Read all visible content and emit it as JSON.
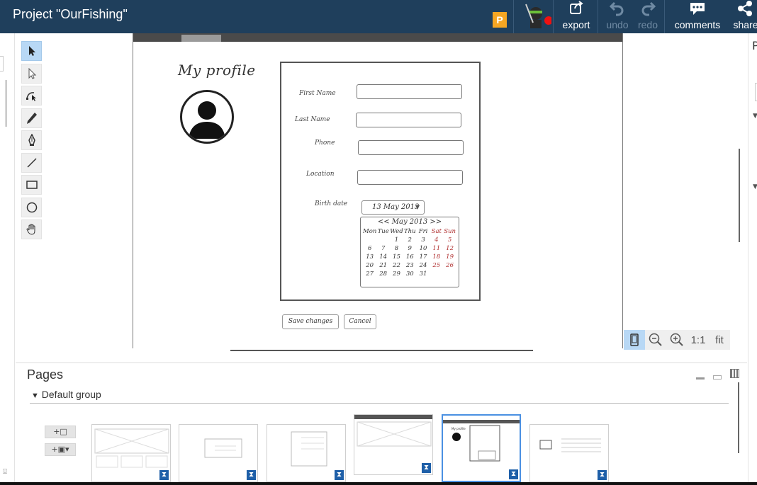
{
  "app": {
    "title": "Project \"OurFishing\"",
    "badge": "P"
  },
  "toolbar": {
    "export_label": "export",
    "undo_label": "undo",
    "redo_label": "redo",
    "comments_label": "comments",
    "share_label": "share"
  },
  "tools": [
    "select-icon",
    "direct-select-icon",
    "bezier-icon",
    "pencil-icon",
    "pen-icon",
    "line-icon",
    "rectangle-icon",
    "ellipse-icon",
    "hand-icon"
  ],
  "mockup": {
    "title": "My profile",
    "fields": [
      "First Name",
      "Last Name",
      "Phone",
      "Location"
    ],
    "birth_label": "Birth date",
    "birth_value": "13 May 2013",
    "calendar": {
      "header": "<< May 2013 >>",
      "weekdays": [
        "Mon",
        "Tue",
        "Wed",
        "Thu",
        "Fri",
        "Sat",
        "Sun"
      ],
      "days": [
        "",
        "",
        "1",
        "2",
        "3",
        "4",
        "5",
        "6",
        "7",
        "8",
        "9",
        "10",
        "11",
        "12",
        "13",
        "14",
        "15",
        "16",
        "17",
        "18",
        "19",
        "20",
        "21",
        "22",
        "23",
        "24",
        "25",
        "26",
        "27",
        "28",
        "29",
        "30",
        "31",
        "",
        "",
        ""
      ]
    },
    "save_label": "Save changes",
    "cancel_label": "Cancel"
  },
  "zoom": {
    "one_to_one": "1:1",
    "fit": "fit"
  },
  "pages": {
    "title": "Pages",
    "group_label": "Default group",
    "add_page": "+□",
    "add_variant": "+▣▾"
  },
  "colors": {
    "topbar": "#1f3f5c",
    "accent": "#b8d8f5",
    "badge": "#f5a623",
    "weekend": "#b03030"
  }
}
